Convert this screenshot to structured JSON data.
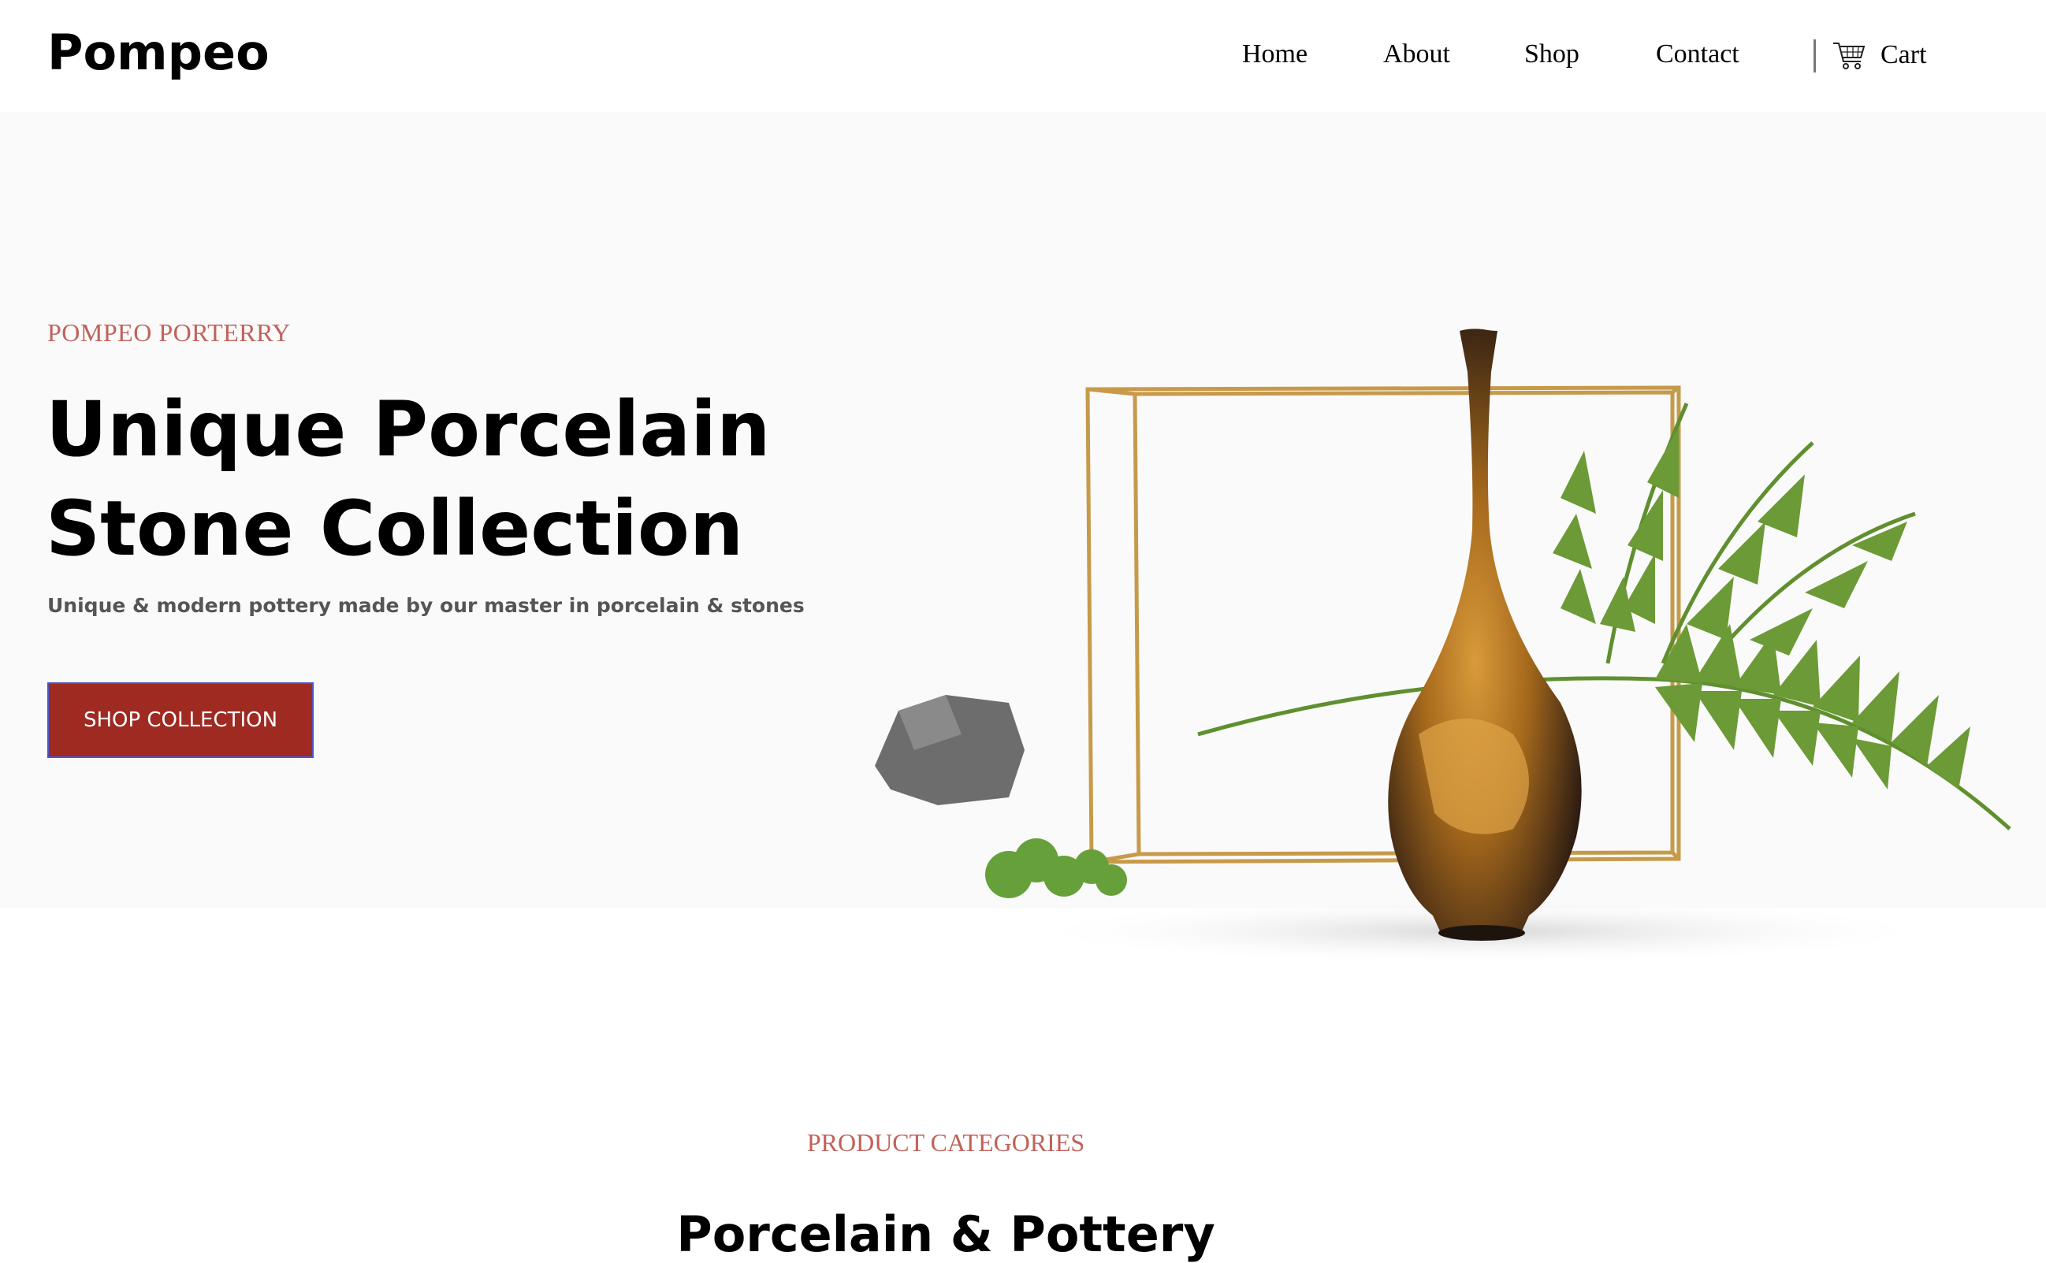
{
  "header": {
    "logo": "Pompeo",
    "nav": [
      "Home",
      "About",
      "Shop",
      "Contact"
    ],
    "cart_label": "Cart",
    "cart_icon": "shopping-cart-icon"
  },
  "hero": {
    "eyebrow": "POMPEO PORTERRY",
    "title_line1": "Unique Porcelain",
    "title_line2": "Stone Collection",
    "subtitle": "Unique & modern pottery made by our master in porcelain & stones",
    "button_label": "SHOP COLLECTION"
  },
  "categories": {
    "eyebrow": "PRODUCT CATEGORIES",
    "title": "Porcelain & Pottery"
  },
  "colors": {
    "accent": "#c0625a",
    "button": "#9e2a22",
    "hero_bg": "#fafafa"
  }
}
